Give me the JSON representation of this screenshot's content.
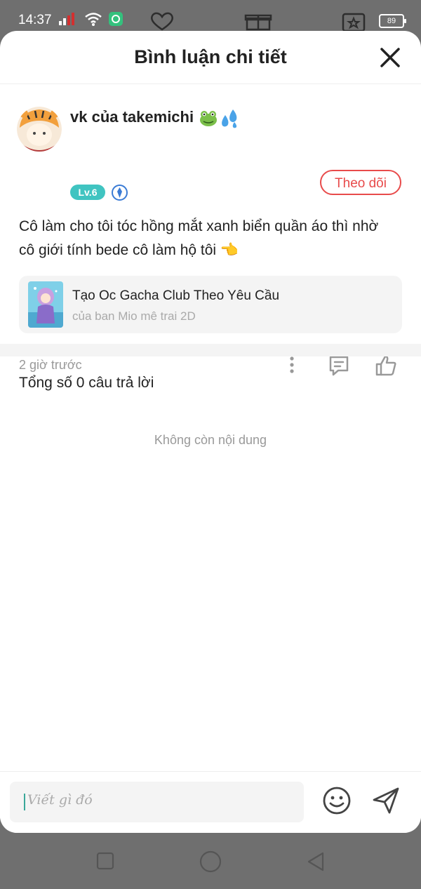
{
  "status_bar": {
    "time": "14:37",
    "battery": "89",
    "icons": [
      "signal-icon",
      "wifi-icon",
      "app-notification-icon",
      "battery-icon"
    ]
  },
  "sheet": {
    "title": "Bình luận chi tiết",
    "close_icon": "close-icon"
  },
  "comment": {
    "user_name": "vk của takemichi",
    "name_emojis": [
      "frog-emoji",
      "sweat-droplets-emoji"
    ],
    "level": "Lv.6",
    "follow_label": "Theo dõi",
    "text": "Cô làm cho tôi tóc hồng mắt xanh biển quần áo thì nhờ cô giới tính bede cô làm hộ tôi 👈",
    "reference": {
      "title": "Tạo Oc Gacha Club Theo Yêu Cầu",
      "subtitle": "của ban Mio mê trai 2D"
    },
    "time_ago": "2 giờ trước",
    "actions": [
      "more-icon",
      "reply-icon",
      "like-icon"
    ]
  },
  "replies": {
    "total_label": "Tổng số 0 câu trả lời",
    "empty_label": "Không còn nội dung"
  },
  "composer": {
    "placeholder": "Viết gì đó",
    "emoji_icon": "emoji-icon",
    "send_icon": "send-icon"
  },
  "colors": {
    "accent_red": "#e84b4b",
    "level_teal": "#40c4c1",
    "vip_blue": "#3a7bd5",
    "cursor_teal": "#3aa89a"
  }
}
